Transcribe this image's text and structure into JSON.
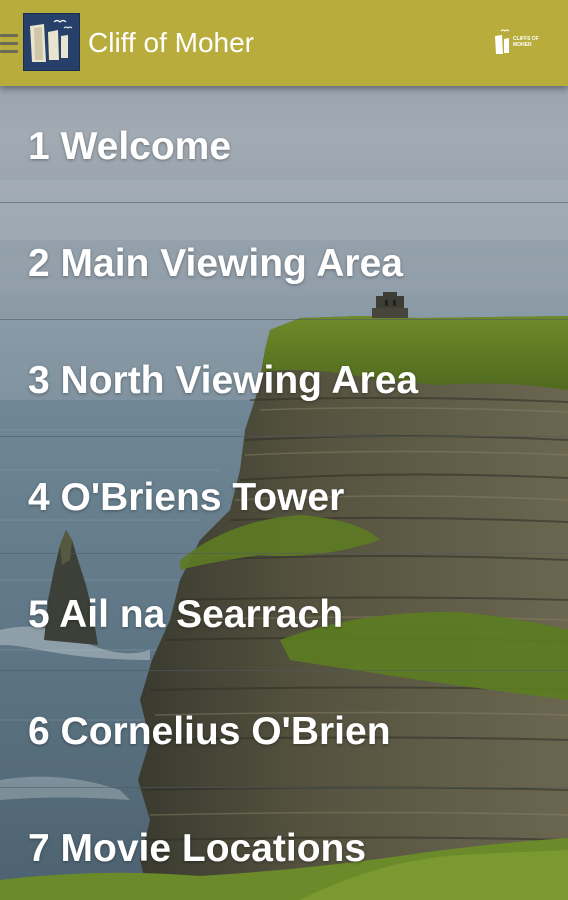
{
  "app_bar": {
    "title": "Cliff of Moher",
    "menu_icon": "hamburger-menu-icon",
    "app_icon": "cliff-logo-icon",
    "brand_logo_icon": "cliffs-of-moher-brand-logo",
    "brand_logo_text_line1": "CLIFFS OF",
    "brand_logo_text_line2": "MOHER",
    "background_color": "#b8ad3c"
  },
  "menu": {
    "items": [
      {
        "label": "1 Welcome"
      },
      {
        "label": "2 Main Viewing Area"
      },
      {
        "label": "3 North Viewing Area"
      },
      {
        "label": "4 O'Briens Tower"
      },
      {
        "label": "5 Ail na Searrach"
      },
      {
        "label": "6 Cornelius O'Brien"
      },
      {
        "label": "7 Movie Locations"
      }
    ]
  },
  "background": {
    "description_icon": "cliffs-photo-background"
  }
}
